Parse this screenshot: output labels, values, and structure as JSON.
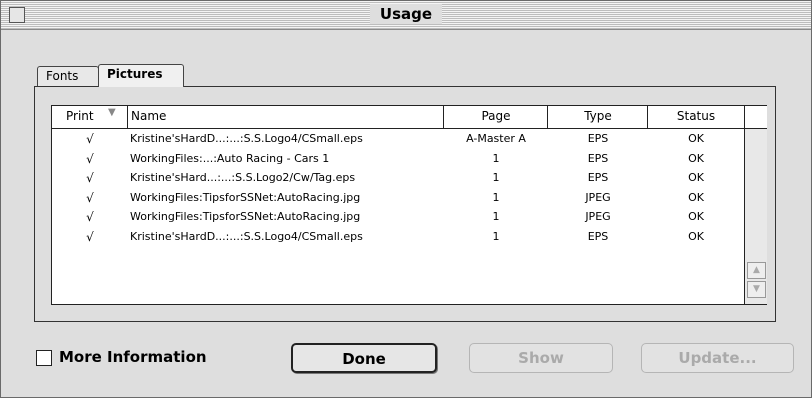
{
  "window": {
    "title": "Usage"
  },
  "tabs": [
    {
      "label": "Fonts",
      "selected": false
    },
    {
      "label": "Pictures",
      "selected": true
    }
  ],
  "table": {
    "columns": [
      "Print",
      "Name",
      "Page",
      "Type",
      "Status"
    ],
    "rows": [
      {
        "print": "√",
        "name": "Kristine'sHardD...:...:S.S.Logo4/CSmall.eps",
        "page": "A-Master A",
        "type": "EPS",
        "status": "OK"
      },
      {
        "print": "√",
        "name": "WorkingFiles:...:Auto Racing - Cars 1",
        "page": "1",
        "type": "EPS",
        "status": "OK"
      },
      {
        "print": "√",
        "name": "Kristine'sHard...:...:S.S.Logo2/Cw/Tag.eps",
        "page": "1",
        "type": "EPS",
        "status": "OK"
      },
      {
        "print": "√",
        "name": "WorkingFiles:TipsforSSNet:AutoRacing.jpg",
        "page": "1",
        "type": "JPEG",
        "status": "OK"
      },
      {
        "print": "√",
        "name": "WorkingFiles:TipsforSSNet:AutoRacing.jpg",
        "page": "1",
        "type": "JPEG",
        "status": "OK"
      },
      {
        "print": "√",
        "name": "Kristine'sHardD...:...:S.S.Logo4/CSmall.eps",
        "page": "1",
        "type": "EPS",
        "status": "OK"
      }
    ]
  },
  "more_info": {
    "label": "More Information",
    "checked": false
  },
  "buttons": {
    "done": "Done",
    "show": "Show",
    "update": "Update..."
  },
  "colors": {
    "disabled_text": "#aaaaaa",
    "window_bg": "#dedede"
  }
}
